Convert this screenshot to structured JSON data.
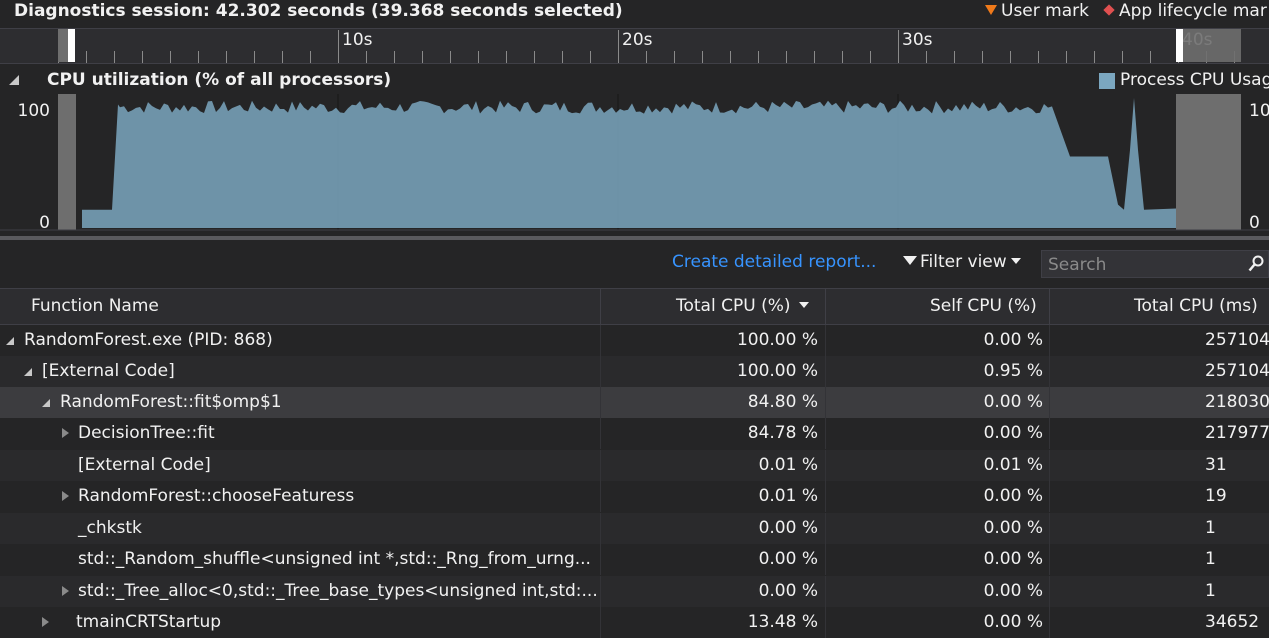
{
  "header": {
    "title": "Diagnostics session: 42.302 seconds (39.368 seconds selected)",
    "legend_user_mark": "User mark",
    "legend_app_lifecycle": "App lifecycle mar"
  },
  "ruler": {
    "labels": [
      "10s",
      "20s",
      "30s",
      "40s"
    ]
  },
  "cpu": {
    "title": "CPU utilization (% of all processors)",
    "legend_label": "Process CPU Usag",
    "y_max_label": "100",
    "y_min_label": "0",
    "y_max_label_right": "10",
    "y_min_label_right": "0",
    "series_color": "#7ba7c0"
  },
  "toolbar": {
    "create_report": "Create detailed report...",
    "filter_view": "Filter view",
    "search_placeholder": "Search"
  },
  "table": {
    "columns": [
      "Function Name",
      "Total CPU (%)",
      "Self CPU (%)",
      "Total CPU (ms)"
    ],
    "rows": [
      {
        "name": "RandomForest.exe (PID: 868)",
        "total_pct": "100.00 %",
        "self_pct": "0.00 %",
        "total_ms": "257104"
      },
      {
        "name": "[External Code]",
        "total_pct": "100.00 %",
        "self_pct": "0.95 %",
        "total_ms": "257104"
      },
      {
        "name": "RandomForest::fit$omp$1",
        "total_pct": "84.80 %",
        "self_pct": "0.00 %",
        "total_ms": "218030"
      },
      {
        "name": "DecisionTree::fit",
        "total_pct": "84.78 %",
        "self_pct": "0.00 %",
        "total_ms": "217977"
      },
      {
        "name": "[External Code]",
        "total_pct": "0.01 %",
        "self_pct": "0.01 %",
        "total_ms": "31"
      },
      {
        "name": "RandomForest::chooseFeaturess",
        "total_pct": "0.01 %",
        "self_pct": "0.00 %",
        "total_ms": "19"
      },
      {
        "name": "_chkstk",
        "total_pct": "0.00 %",
        "self_pct": "0.00 %",
        "total_ms": "1"
      },
      {
        "name": "std::_Random_shuffle<unsigned int *,std::_Rng_from_urng...",
        "total_pct": "0.00 %",
        "self_pct": "0.00 %",
        "total_ms": "1"
      },
      {
        "name": "std::_Tree_alloc<0,std::_Tree_base_types<unsigned int,std:...",
        "total_pct": "0.00 %",
        "self_pct": "0.00 %",
        "total_ms": "1"
      },
      {
        "name": "tmainCRTStartup",
        "total_pct": "13.48 %",
        "self_pct": "0.00 %",
        "total_ms": "34652"
      }
    ]
  }
}
